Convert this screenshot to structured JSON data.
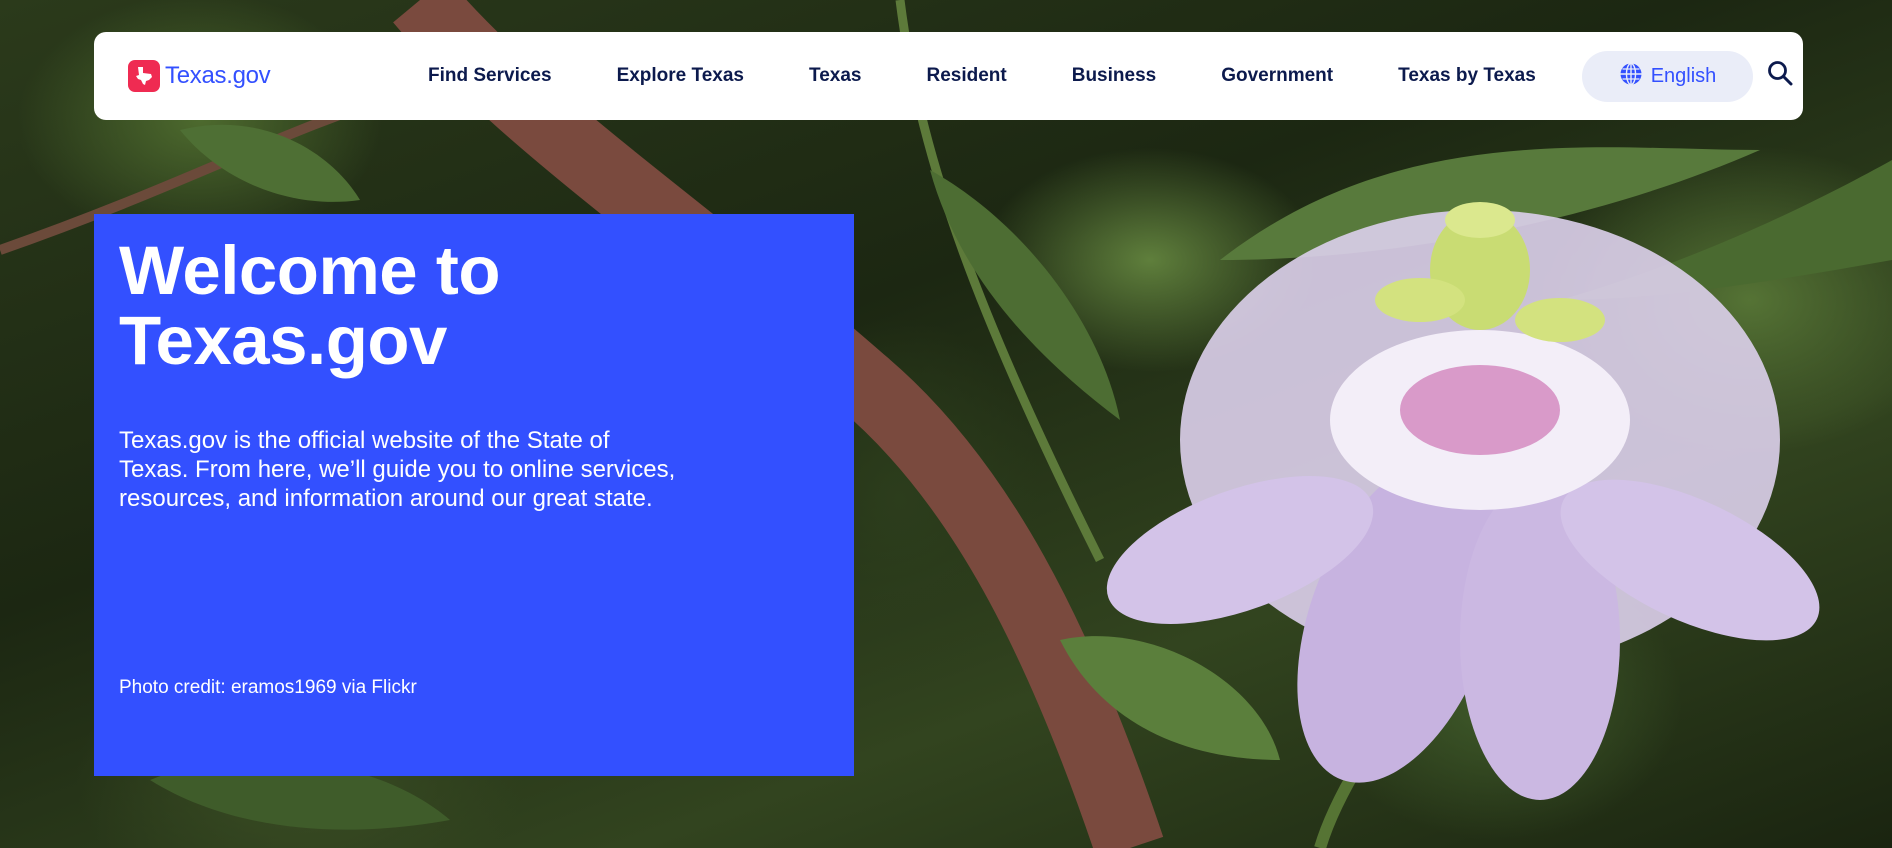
{
  "brand": {
    "name": "Texas.gov",
    "logo_icon": "texas-state-icon",
    "logo_color": "#ef2b52",
    "accent": "#3350ff"
  },
  "nav": {
    "items": [
      {
        "label": "Find Services"
      },
      {
        "label": "Explore Texas"
      },
      {
        "label": "Texas"
      },
      {
        "label": "Resident"
      },
      {
        "label": "Business"
      },
      {
        "label": "Government"
      },
      {
        "label": "Texas by Texas"
      }
    ]
  },
  "language": {
    "label": "English",
    "icon": "globe-icon"
  },
  "search": {
    "icon": "search-icon"
  },
  "hero": {
    "title": "Welcome to Texas.gov",
    "body": "Texas.gov is the official website of the State of Texas. From here, we’ll guide you to online services, resources, and information around our great state.",
    "credit": "Photo credit: eramos1969 via Flickr",
    "background": "#3350ff"
  },
  "background_image": {
    "subject": "passion-flower-photo"
  }
}
